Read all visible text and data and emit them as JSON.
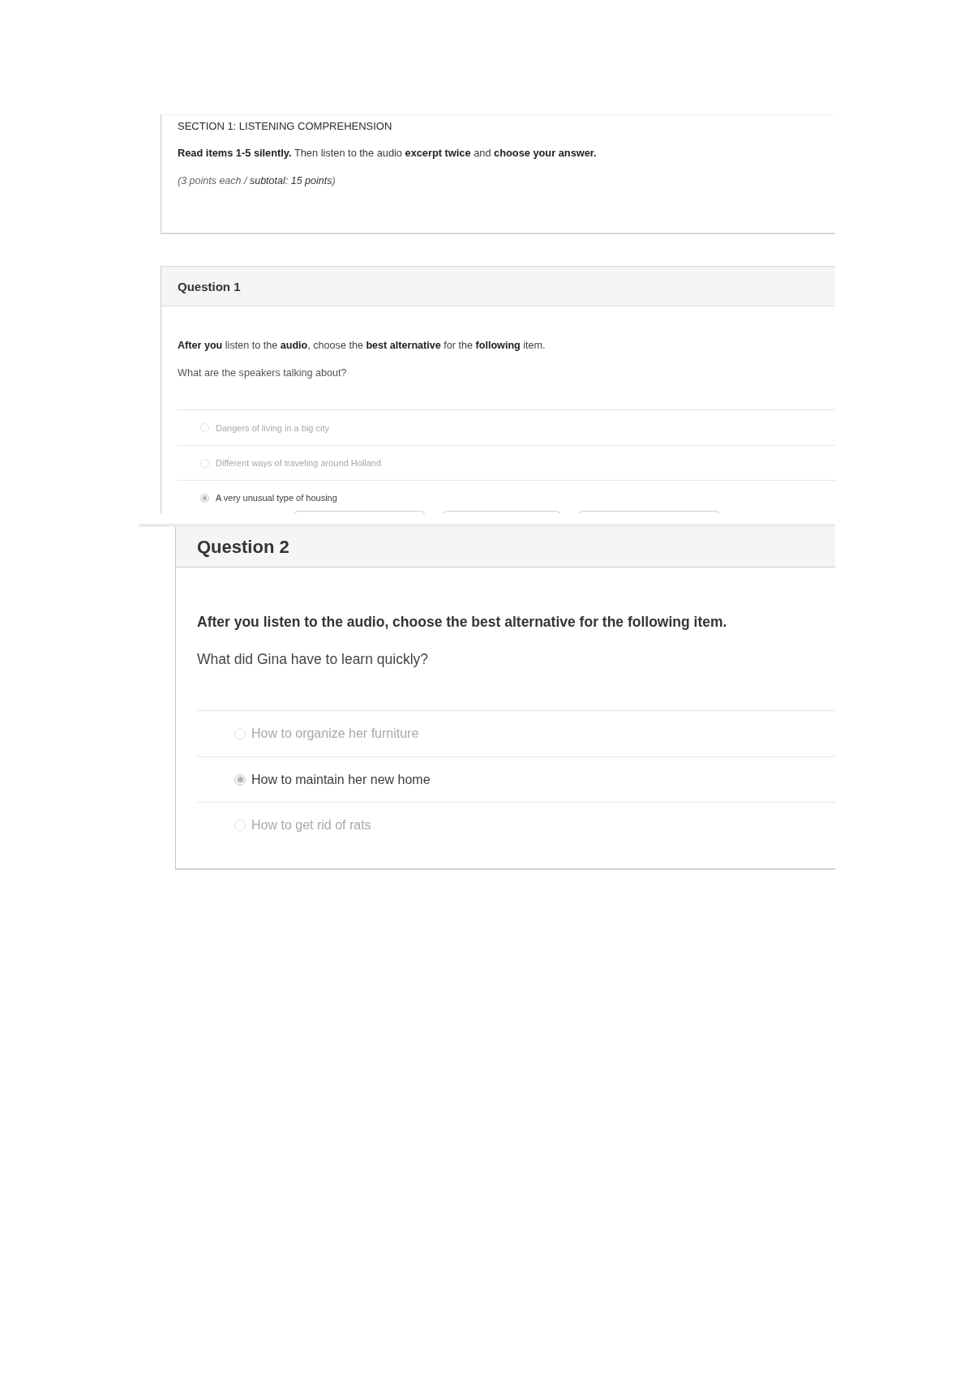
{
  "first_screenshot": {
    "section": {
      "title": "SECTION 1: LISTENING COMPREHENSION",
      "instructions": "**Read items 1-5 silently.** Then listen to the audio **excerpt twice** and **choose your answer.**",
      "points": "(3 points each / **subtotal: 15 points**)"
    },
    "question": {
      "title": "Question 1",
      "instruction": "**After you** listen to the **audio**, choose the **best alternative** for the **following** item.",
      "prompt": "What are the speakers talking about?",
      "options": [
        {
          "label": "Dangers of living in a big city",
          "selected": false
        },
        {
          "label": "Different ways of traveling around Holland",
          "selected": false
        },
        {
          "label": "A very unusual type of housing",
          "selected": true
        }
      ]
    }
  },
  "second_screenshot": {
    "question": {
      "title": "Question 2",
      "instruction": "After you listen to the audio, choose the best alternative for the following item.",
      "prompt": "What did Gina have to learn quickly?",
      "options": [
        {
          "label": "How to organize her furniture",
          "selected": false
        },
        {
          "label": "How to maintain her new home",
          "selected": true
        },
        {
          "label": "How to get rid of rats",
          "selected": false
        }
      ]
    }
  }
}
